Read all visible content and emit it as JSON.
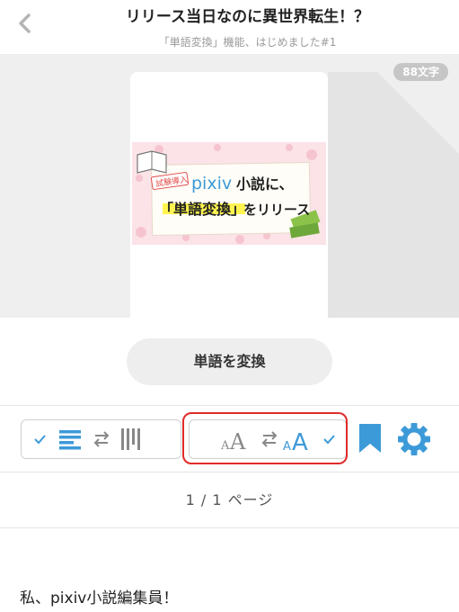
{
  "header": {
    "title": "リリース当日なのに異世界転生！？",
    "subtitle": "「単語変換」機能、はじめました#1"
  },
  "cover": {
    "char_count": "88文字",
    "banner_tag": "試験導入",
    "banner_line1_brand": "pixiv",
    "banner_line1_rest": "小説に、",
    "banner_line2_highlight": "「単語変換」",
    "banner_line2_rest": "をリリース"
  },
  "actions": {
    "convert_label": "単語を変換"
  },
  "toolbar": {
    "layout_toggle_selected": "horizontal",
    "font_toggle_selected": "large",
    "font_small_glyph": "A",
    "font_large_glyph": "A"
  },
  "pagination": {
    "label": "1 / 1 ページ"
  },
  "content": {
    "first_line": "私、pixiv小説編集員！"
  },
  "colors": {
    "accent": "#3d9ad8",
    "highlight_ring": "#e12a2a",
    "banner_bg": "#fbe3e8",
    "yellow_highlight": "#fff44f"
  }
}
